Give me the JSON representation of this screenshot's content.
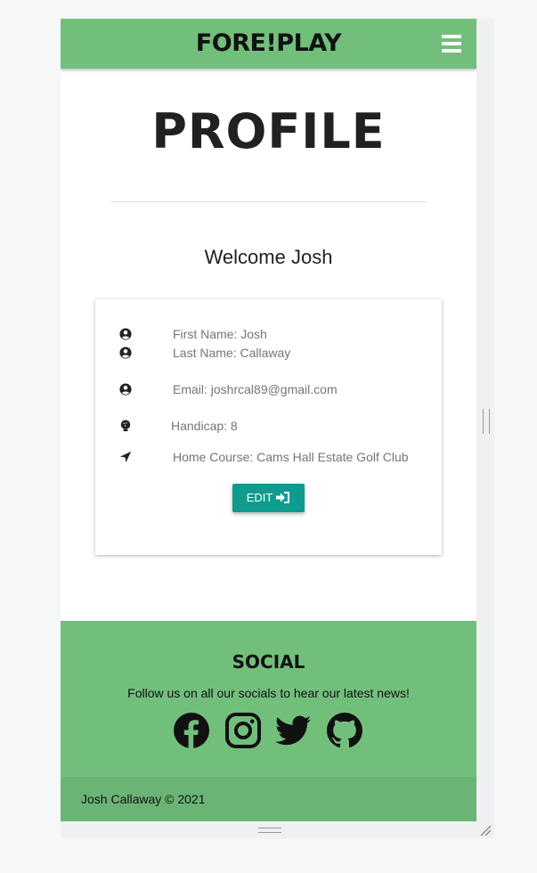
{
  "navbar": {
    "brand": "FORE!PLAY",
    "menu_icon": "hamburger-menu-icon",
    "color": "#72bf7c"
  },
  "main": {
    "title": "PROFILE",
    "welcome": "Welcome Josh"
  },
  "profile_card": {
    "first_name": "First Name: Josh",
    "last_name": "Last Name: Callaway",
    "email": "Email: joshrcal89@gmail.com",
    "handicap": "Handicap: 8",
    "home_course": "Home Course: Cams Hall Estate Golf Club",
    "icons": [
      "user-circle-icon",
      "user-circle-icon",
      "user-circle-icon",
      "golf-ball-icon",
      "location-arrow-icon"
    ],
    "edit_label": "EDIT",
    "edit_color": "#0f9b8e"
  },
  "footer": {
    "title": "SOCIAL",
    "text": "Follow us on all our socials to hear our latest news!",
    "socials": [
      "facebook-icon",
      "instagram-icon",
      "twitter-icon",
      "github-icon"
    ],
    "copyright": "Josh Callaway © 2021"
  }
}
